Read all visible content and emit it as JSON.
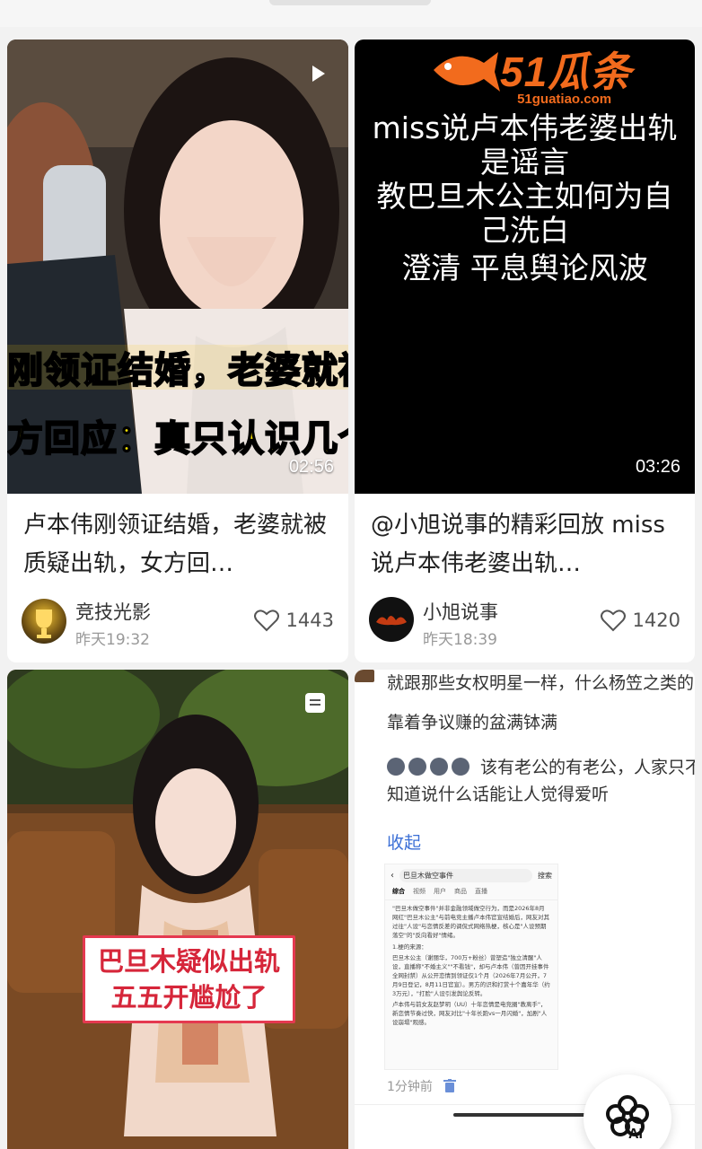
{
  "feed": {
    "cards": [
      {
        "duration": "02:56",
        "title": "卢本伟刚领证结婚，老婆就被质疑出轨，女方回…",
        "author": "竞技光影",
        "time": "昨天19:32",
        "likes": "1443",
        "overlay_line1": "刚领证结婚，老婆就被",
        "overlay_line2": "方回应：真只认识几个",
        "avatar_text": "竞技光影"
      },
      {
        "duration": "03:26",
        "title": "@小旭说事的精彩回放 miss说卢本伟老婆出轨…",
        "author": "小旭说事",
        "time": "昨天18:39",
        "likes": "1420",
        "overlay_lines": [
          "miss说卢本伟老婆出轨",
          "是谣言",
          "教巴旦木公主如何为自",
          "己洗白",
          "澄清 平息舆论风波"
        ],
        "watermark_brand": "51瓜条",
        "watermark_url": "51guatiao.com"
      },
      {
        "bubble_line1": "巴旦木疑似出轨",
        "bubble_line2": "五五开尴尬了"
      },
      {
        "comment_line1": "就跟那些女权明星一样，什么杨笠之类的",
        "comment_line2": "靠着争议赚的盆满钵满",
        "comment_line3": "该有老公的有老公，人家只不",
        "comment_line4": "知道说什么话能让人觉得爱听",
        "collapse_label": "收起",
        "comment_time": "1分钟前",
        "shot_search_title": "巴旦木做空事件",
        "shot_search_btn": "搜索",
        "shot_tabs": [
          "综合",
          "视频",
          "用户",
          "商品",
          "直播"
        ],
        "shot_para1": "\"巴旦木做空事件\"并非金融领域做空行为，而是2026年8月网红\"巴旦木公主\"与前电竞主播卢本伟官宣结婚后，网友对其过往\"人设\"与恋情反差的调侃式网络热梗，核心是\"人设预期落空\"的\"反向看好\"情绪。",
        "shot_para2": "1.梗的来源：",
        "shot_bullet1": "巴旦木公主（谢丽华，700万+粉丝）曾塑造\"独立清醒\"人设，直播称\"不婚主义\"\"不看钱\"，却与卢本伟（曾因开挂事件全网封禁）从公开恋情到领证仅1个月（2026年7月公开，7月9日登记，8月11日官宣）。男方的识和打赏十个嘉年华（约3万元），\"打脸\"人设引发舆论反转。",
        "shot_bullet2": "卢本伟与前女友赵梦玥（UU）十年恋情是电竞圈\"教离手\"，新恋情节奏过快，网友对比\"十年长跑vs一月闪婚\"，加剧\"人设崩塌\"观感。"
      }
    ]
  },
  "fab": {
    "label": "AI"
  },
  "colors": {
    "accent_red": "#e53950",
    "watermark_orange": "#f26b1d",
    "link_blue": "#3b6fd6"
  }
}
